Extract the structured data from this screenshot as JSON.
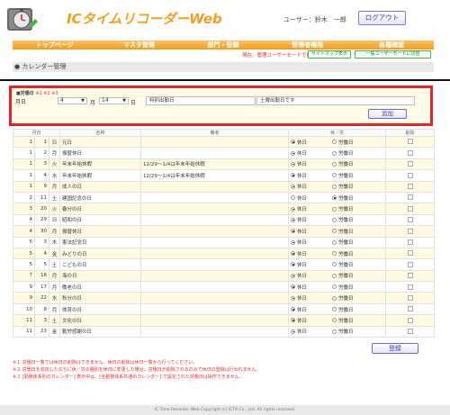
{
  "header": {
    "app_title": "ICタイムリコーダーWeb",
    "user_text": "ユーザー：鈴木　一郎",
    "logout_label": "ログアウト"
  },
  "nav": {
    "items": [
      {
        "label": "トップページ"
      },
      {
        "label": "マスタ管理"
      },
      {
        "label": "部門・役職"
      },
      {
        "label": "管理者権限"
      },
      {
        "label": "各種確認"
      }
    ]
  },
  "subbar": {
    "mode_text": "現在、管理ユーザーモードで操作中です。",
    "sitemap_label": "サイトマップ表示",
    "general_mode_label": "一般ユーザーモードに切替"
  },
  "section": {
    "title": "● カレンダー管理"
  },
  "form": {
    "heading": "■労働日",
    "heading_sub": "※1 ※2 ※3",
    "day_label": "月日",
    "month_value": "4",
    "month_unit": "月",
    "day_value": "14",
    "day_unit": "日",
    "name_value": "特別出勤日",
    "note_value": "土曜出勤日です",
    "add_label": "追加"
  },
  "table": {
    "headers": [
      "月日",
      "",
      "",
      "名称",
      "備考",
      "休／労",
      "削除"
    ],
    "holiday_label": "休日",
    "workday_label": "労働日",
    "rows": [
      {
        "m": "1",
        "d": "1",
        "w": "日",
        "name": "元日",
        "note": "",
        "work": false
      },
      {
        "m": "1",
        "d": "2",
        "w": "月",
        "name": "振替休日",
        "note": "",
        "work": false
      },
      {
        "m": "1",
        "d": "3",
        "w": "火",
        "name": "年末年始休暇",
        "note": "12/29～1/4は年末年始休暇",
        "work": false
      },
      {
        "m": "1",
        "d": "4",
        "w": "水",
        "name": "年末年始休暇",
        "note": "12/29～1/4は年末年始休暇",
        "work": false
      },
      {
        "m": "1",
        "d": "9",
        "w": "月",
        "name": "成人の日",
        "note": "",
        "work": false
      },
      {
        "m": "2",
        "d": "11",
        "w": "土",
        "name": "建国記念の日",
        "note": "",
        "work": true
      },
      {
        "m": "3",
        "d": "20",
        "w": "火",
        "name": "春分の日",
        "note": "",
        "work": false
      },
      {
        "m": "4",
        "d": "29",
        "w": "日",
        "name": "昭和の日",
        "note": "",
        "work": false
      },
      {
        "m": "4",
        "d": "30",
        "w": "月",
        "name": "振替休日",
        "note": "",
        "work": false
      },
      {
        "m": "5",
        "d": "3",
        "w": "木",
        "name": "憲法記念日",
        "note": "",
        "work": false
      },
      {
        "m": "5",
        "d": "4",
        "w": "金",
        "name": "みどりの日",
        "note": "",
        "work": false
      },
      {
        "m": "5",
        "d": "5",
        "w": "土",
        "name": "こどもの日",
        "note": "",
        "work": false
      },
      {
        "m": "7",
        "d": "16",
        "w": "月",
        "name": "海の日",
        "note": "",
        "work": false
      },
      {
        "m": "9",
        "d": "17",
        "w": "月",
        "name": "敬老の日",
        "note": "",
        "work": false
      },
      {
        "m": "9",
        "d": "22",
        "w": "水",
        "name": "秋分の日",
        "note": "",
        "work": false
      },
      {
        "m": "10",
        "d": "8",
        "w": "月",
        "name": "体育の日",
        "note": "",
        "work": false
      },
      {
        "m": "11",
        "d": "3",
        "w": "土",
        "name": "文化の日",
        "note": "",
        "work": false
      },
      {
        "m": "11",
        "d": "23",
        "w": "金",
        "name": "勤労感謝の日",
        "note": "",
        "work": false
      }
    ]
  },
  "register_label": "登録",
  "notes": [
    "※１ 労働日一覧では休日の削除はできません。休日の削除は休日一覧から行ってください。",
    "※２ 労働日を追加したのちに休／労の種別を休日に変更した場合、労働日が削除されるのみで休日の登録は行われません。",
    "※３ [勤務体系別のカレンダー] 表示中は、[全勤務体系共通のカレンダー] で設定された労働日は操作できません。"
  ],
  "footer": "IC Time Recorder Web Copyright (c) ICTR Co., Ltd. All rights reserved."
}
